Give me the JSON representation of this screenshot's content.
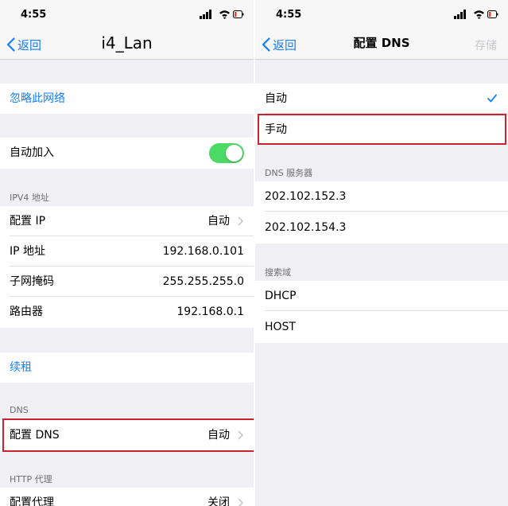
{
  "left": {
    "status_time": "4:55",
    "back_label": "返回",
    "title": "i4_Lan",
    "forget_label": "忽略此网络",
    "auto_join_label": "自动加入",
    "ipv4_header": "IPV4 地址",
    "ipv4_rows": [
      {
        "label": "配置 IP",
        "value": "自动"
      },
      {
        "label": "IP 地址",
        "value": "192.168.0.101"
      },
      {
        "label": "子网掩码",
        "value": "255.255.255.0"
      },
      {
        "label": "路由器",
        "value": "192.168.0.1"
      }
    ],
    "renew_label": "续租",
    "dns_header": "DNS",
    "dns_row": {
      "label": "配置 DNS",
      "value": "自动"
    },
    "http_header": "HTTP 代理",
    "proxy_row": {
      "label": "配置代理",
      "value": "关闭"
    }
  },
  "right": {
    "status_time": "4:55",
    "back_label": "返回",
    "title": "配置 DNS",
    "save_label": "存储",
    "mode_options": [
      "自动",
      "手动"
    ],
    "selected_option": "自动",
    "dns_servers_header": "DNS 服务器",
    "dns_servers": [
      "202.102.152.3",
      "202.102.154.3"
    ],
    "search_domains_header": "搜索域",
    "search_domains": [
      "DHCP",
      "HOST"
    ]
  },
  "colors": {
    "ios_blue": "#157efb",
    "toggle_green": "#4cd964",
    "highlight_red": "#c9232e",
    "group_background": "#efeff4"
  }
}
